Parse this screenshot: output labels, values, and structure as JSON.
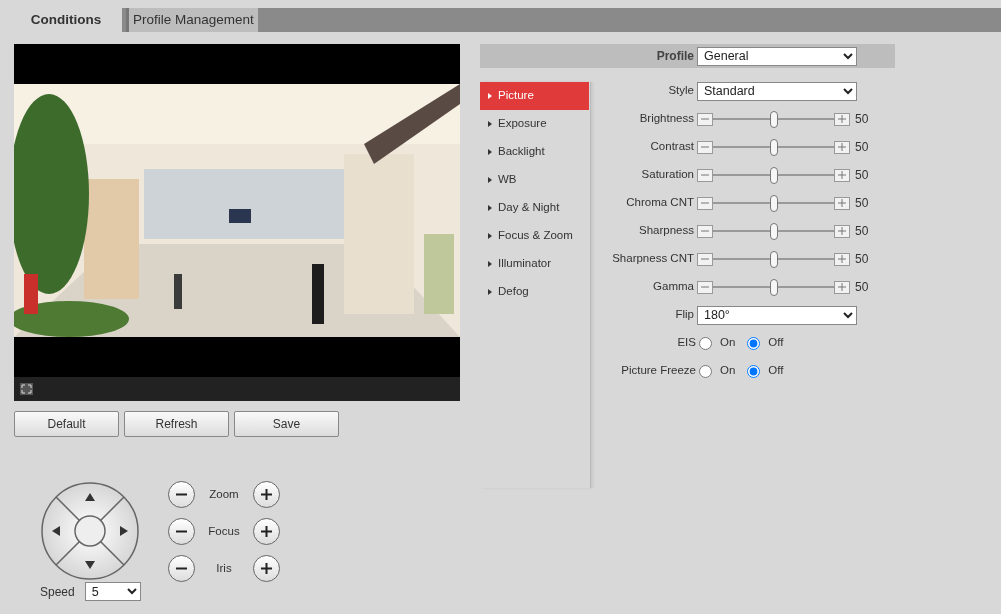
{
  "tabs": [
    {
      "label": "Conditions",
      "selected": true
    },
    {
      "label": "Profile Management",
      "selected": false
    }
  ],
  "buttons": [
    "Default",
    "Refresh",
    "Save"
  ],
  "ptz": {
    "controls": [
      {
        "label": "Zoom"
      },
      {
        "label": "Focus"
      },
      {
        "label": "Iris"
      }
    ],
    "speed": {
      "label": "Speed",
      "value": "5"
    }
  },
  "profile": {
    "label": "Profile",
    "value": "General"
  },
  "menu": [
    {
      "label": "Picture",
      "selected": true
    },
    {
      "label": "Exposure",
      "selected": false
    },
    {
      "label": "Backlight",
      "selected": false
    },
    {
      "label": "WB",
      "selected": false
    },
    {
      "label": "Day & Night",
      "selected": false
    },
    {
      "label": "Focus & Zoom",
      "selected": false
    },
    {
      "label": "Illuminator",
      "selected": false
    },
    {
      "label": "Defog",
      "selected": false
    }
  ],
  "settings": [
    {
      "kind": "select",
      "label": "Style",
      "value": "Standard"
    },
    {
      "kind": "slider",
      "label": "Brightness",
      "level": 0.5,
      "reading": "50"
    },
    {
      "kind": "slider",
      "label": "Contrast",
      "level": 0.5,
      "reading": "50"
    },
    {
      "kind": "slider",
      "label": "Saturation",
      "level": 0.5,
      "reading": "50"
    },
    {
      "kind": "slider",
      "label": "Chroma CNT",
      "level": 0.5,
      "reading": "50"
    },
    {
      "kind": "slider",
      "label": "Sharpness",
      "level": 0.5,
      "reading": "50"
    },
    {
      "kind": "slider",
      "label": "Sharpness CNT",
      "level": 0.5,
      "reading": "50"
    },
    {
      "kind": "slider",
      "label": "Gamma",
      "level": 0.5,
      "reading": "50"
    },
    {
      "kind": "select",
      "label": "Flip",
      "value": "180°"
    },
    {
      "kind": "radio",
      "label": "EIS",
      "options": [
        {
          "label": "On",
          "selected": false
        },
        {
          "label": "Off",
          "selected": true
        }
      ]
    },
    {
      "kind": "radio",
      "label": "Picture Freeze",
      "options": [
        {
          "label": "On",
          "selected": false
        },
        {
          "label": "Off",
          "selected": true
        }
      ]
    }
  ]
}
